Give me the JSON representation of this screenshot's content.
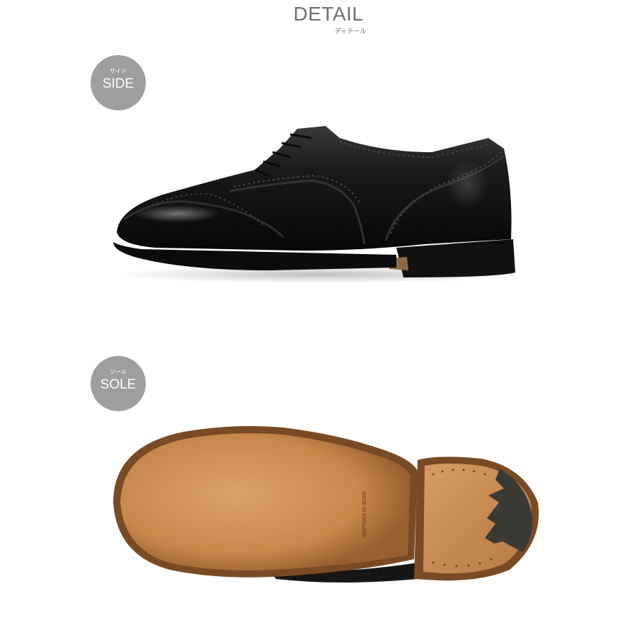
{
  "header": {
    "title": "DETAIL",
    "subtitle": "ディテール"
  },
  "sections": {
    "side": {
      "sub_label": "サイド",
      "label": "SIDE",
      "image": "black-oxford-wingtip-brogue-side-view"
    },
    "sole": {
      "sub_label": "ソール",
      "label": "SOLE",
      "image": "leather-sole-bottom-view",
      "sole_stamp": "MADE IN ENGLAND"
    }
  },
  "colors": {
    "heading": "#6f6f6f",
    "badge": "#9e9e9e",
    "badge_text": "#ffffff",
    "shoe_leather": "#141414",
    "sole_leather": "#c98a4e"
  }
}
